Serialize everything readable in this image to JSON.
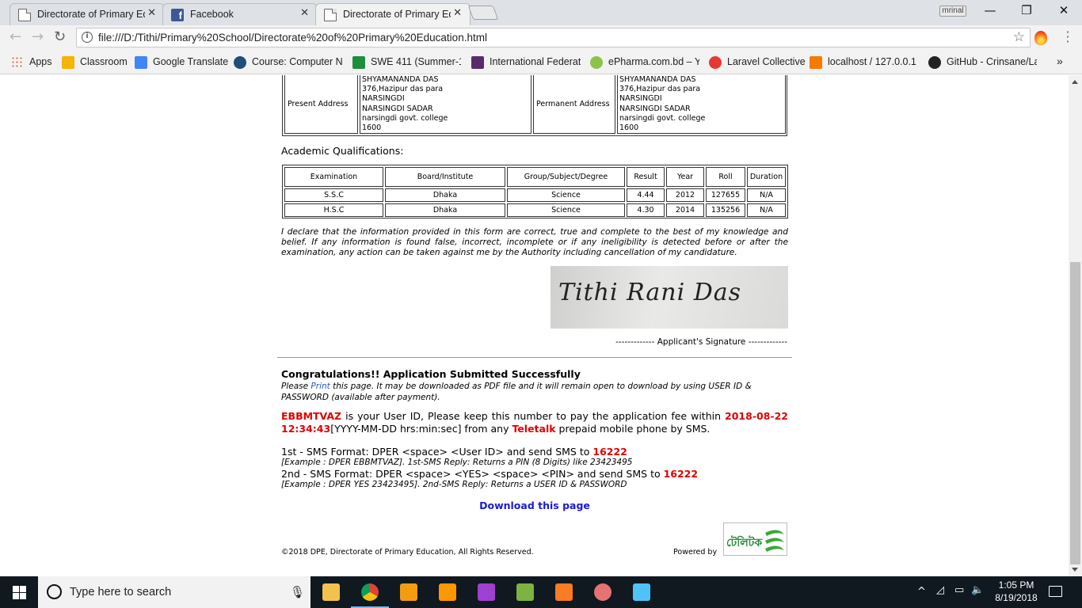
{
  "browser": {
    "tabs": [
      {
        "title": "Directorate of Primary Ed",
        "icon": "document-icon"
      },
      {
        "title": "Facebook",
        "icon": "facebook-icon"
      },
      {
        "title": "Directorate of Primary Ed",
        "icon": "document-icon"
      }
    ],
    "close_glyph": "✕",
    "profile_name": "mrinal",
    "window_controls": [
      "—",
      "❐",
      "✕"
    ],
    "nav": {
      "back": "←",
      "forward": "→",
      "reload": "↻"
    },
    "url": "file:///D:/Tithi/Primary%20School/Directorate%20of%20Primary%20Education.html",
    "star": "☆",
    "bookmarks": [
      {
        "label": "Apps",
        "color": "#e44d26"
      },
      {
        "label": "Classroom",
        "color": "#f4b400"
      },
      {
        "label": "Google Translate",
        "color": "#4285f4"
      },
      {
        "label": "Course: Computer Ne",
        "color": "#1f4e79"
      },
      {
        "label": "SWE 411 (Summer-18",
        "color": "#1e8e3e"
      },
      {
        "label": "International Federati",
        "color": "#5a2a6a"
      },
      {
        "label": "ePharma.com.bd – Yo",
        "color": "#8bc34a"
      },
      {
        "label": "Laravel Collective",
        "color": "#e53935"
      },
      {
        "label": "localhost / 127.0.0.1 |",
        "color": "#f57c00"
      },
      {
        "label": "GitHub - Crinsane/La",
        "color": "#222222"
      }
    ],
    "bookmarks_overflow": "»"
  },
  "page": {
    "address": {
      "present_label": "Present Address",
      "permanent_label": "Permanent Address",
      "present_lines": [
        "SHYAMANANDA DAS",
        "376,Hazipur das para",
        "NARSINGDI",
        "NARSINGDI SADAR",
        "narsingdi govt. college",
        "1600"
      ],
      "permanent_lines": [
        "SHYAMANANDA DAS",
        "376,Hazipur das para",
        "NARSINGDI",
        "NARSINGDI SADAR",
        "narsingdi govt. college",
        "1600"
      ]
    },
    "academic_title": "Academic Qualifications:",
    "academic_headers": [
      "Examination",
      "Board/Institute",
      "Group/Subject/Degree",
      "Result",
      "Year",
      "Roll",
      "Duration"
    ],
    "academic_rows": [
      [
        "S.S.C",
        "Dhaka",
        "Science",
        "4.44",
        "2012",
        "127655",
        "N/A"
      ],
      [
        "H.S.C",
        "Dhaka",
        "Science",
        "4.30",
        "2014",
        "135256",
        "N/A"
      ]
    ],
    "declaration": "I declare that the information provided in this form are correct, true and complete to the best of my knowledge and belief. If any information is found false, incorrect, incomplete or if any ineligibility is detected before or after the examination, any action can be taken against me by the Authority including cancellation of my candidature.",
    "signature_name": "Tithi Rani Das",
    "signature_caption": "------------- Applicant's Signature -------------",
    "congrats": "Congratulations!! Application Submitted Successfully",
    "note_before": "Please ",
    "note_link": "Print",
    "note_after": " this page. It may be downloaded as PDF file and it will remain open to download by using USER ID & PASSWORD (available after payment).",
    "user_id": "EBBMTVAZ",
    "userid_text1": " is your User ID, Please keep this number to pay the application fee within ",
    "deadline": "2018-08-22 12:34:43",
    "userid_text2": "[YYYY-MM-DD hrs:min:sec] from any ",
    "operator": "Teletalk",
    "userid_text3": " prepaid mobile phone by SMS.",
    "sms1_text": "1st - SMS Format: DPER <space> <User ID> and send SMS to ",
    "sms_number": "16222",
    "sms1_example": "[Example : DPER EBBMTVAZ]. 1st-SMS Reply: Returns a PIN (8 Digits) like 23423495",
    "sms2_text": "2nd - SMS Format: DPER <space> <YES> <space> <PIN> and send SMS to ",
    "sms2_example": "[Example : DPER YES 23423495]. 2nd-SMS Reply: Returns a USER ID & PASSWORD",
    "download_label": "Download this page",
    "copyright": "©2018 DPE, Directorate of Primary Education, All Rights Reserved.",
    "powered_by": "Powered by",
    "logo_text": "টেলিটক"
  },
  "taskbar": {
    "search_placeholder": "Type here to search",
    "apps": [
      {
        "name": "file-explorer",
        "color": "#f2c14e"
      },
      {
        "name": "chrome",
        "color": "#db4437"
      },
      {
        "name": "uc-browser",
        "color": "#f39c12"
      },
      {
        "name": "sublime-text",
        "color": "#ff9800"
      },
      {
        "name": "phpstorm",
        "color": "#a040d0"
      },
      {
        "name": "sql-manager",
        "color": "#7cb342"
      },
      {
        "name": "xampp",
        "color": "#fb7a24"
      },
      {
        "name": "snipping-tool",
        "color": "#e57373"
      },
      {
        "name": "control-panel",
        "color": "#4fc3f7"
      }
    ],
    "tray_chevron": "^",
    "time": "1:05 PM",
    "date": "8/19/2018"
  }
}
